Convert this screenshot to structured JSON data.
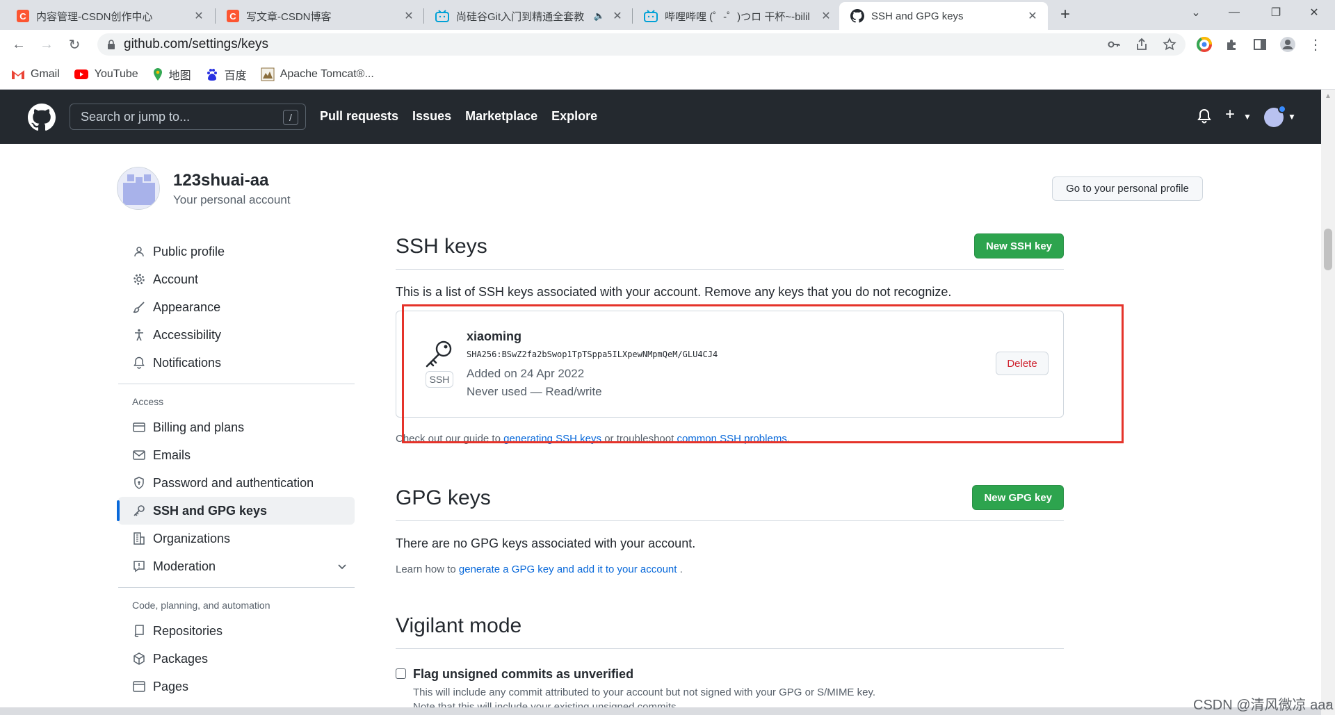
{
  "browser": {
    "tabs": [
      {
        "title": "内容管理-CSDN创作中心",
        "favicon": "csdn-icon"
      },
      {
        "title": "写文章-CSDN博客",
        "favicon": "csdn-icon"
      },
      {
        "title": "尚硅谷Git入门到精通全套教",
        "favicon": "bilibili-icon"
      },
      {
        "title": "哔哩哔哩 (゜-゜)つロ 干杯~-bilil",
        "favicon": "bilibili-icon"
      },
      {
        "title": "SSH and GPG keys",
        "favicon": "github-icon"
      }
    ],
    "url": "github.com/settings/keys",
    "bookmarks": [
      {
        "label": "Gmail",
        "icon": "gmail-icon"
      },
      {
        "label": "YouTube",
        "icon": "youtube-icon"
      },
      {
        "label": "地图",
        "icon": "maps-icon"
      },
      {
        "label": "百度",
        "icon": "baidu-icon"
      },
      {
        "label": "Apache Tomcat®...",
        "icon": "tomcat-icon"
      }
    ]
  },
  "header": {
    "search_placeholder": "Search or jump to...",
    "search_shortcut": "/",
    "nav": [
      "Pull requests",
      "Issues",
      "Marketplace",
      "Explore"
    ]
  },
  "profile": {
    "name": "123shuai-aa",
    "subtitle": "Your personal account",
    "go_profile_label": "Go to your personal profile"
  },
  "sidebar": {
    "group1": [
      {
        "label": "Public profile",
        "icon": "person-icon"
      },
      {
        "label": "Account",
        "icon": "gear-icon"
      },
      {
        "label": "Appearance",
        "icon": "paintbrush-icon"
      },
      {
        "label": "Accessibility",
        "icon": "accessibility-icon"
      },
      {
        "label": "Notifications",
        "icon": "bell-icon"
      }
    ],
    "access_heading": "Access",
    "group2": [
      {
        "label": "Billing and plans",
        "icon": "credit-card-icon"
      },
      {
        "label": "Emails",
        "icon": "mail-icon"
      },
      {
        "label": "Password and authentication",
        "icon": "shield-icon"
      },
      {
        "label": "SSH and GPG keys",
        "icon": "key-icon",
        "active": true
      },
      {
        "label": "Organizations",
        "icon": "organization-icon"
      },
      {
        "label": "Moderation",
        "icon": "report-icon"
      }
    ],
    "code_heading": "Code, planning, and automation",
    "group3": [
      {
        "label": "Repositories",
        "icon": "repo-icon"
      },
      {
        "label": "Packages",
        "icon": "package-icon"
      },
      {
        "label": "Pages",
        "icon": "browser-icon"
      }
    ]
  },
  "ssh": {
    "title": "SSH keys",
    "new_button": "New SSH key",
    "description": "This is a list of SSH keys associated with your account. Remove any keys that you do not recognize.",
    "key": {
      "title": "xiaoming",
      "fingerprint": "SHA256:BSwZ2fa2bSwop1TpTSppa5ILXpewNMpmQeM/GLU4CJ4",
      "added": "Added on 24 Apr 2022",
      "usage": "Never used — Read/write",
      "badge": "SSH",
      "delete_label": "Delete"
    },
    "guide_prefix": "Check out our guide to ",
    "guide_link1": "generating SSH keys",
    "guide_mid": " or troubleshoot ",
    "guide_link2": "common SSH problems",
    "guide_suffix": "."
  },
  "gpg": {
    "title": "GPG keys",
    "new_button": "New GPG key",
    "empty": "There are no GPG keys associated with your account.",
    "learn_prefix": "Learn how to ",
    "learn_link": "generate a GPG key and add it to your account",
    "learn_suffix": " ."
  },
  "vigilant": {
    "title": "Vigilant mode",
    "checkbox_label": "Flag unsigned commits as unverified",
    "desc1": "This will include any commit attributed to your account but not signed with your GPG or S/MIME key.",
    "desc2": "Note that this will include your existing unsigned commits."
  },
  "watermark": "CSDN @清风微凉 aaa",
  "colors": {
    "github_header": "#24292f",
    "primary_green": "#2da44e",
    "link_blue": "#0969da",
    "danger_red": "#cf222e",
    "annotation_red": "#e5332a"
  }
}
